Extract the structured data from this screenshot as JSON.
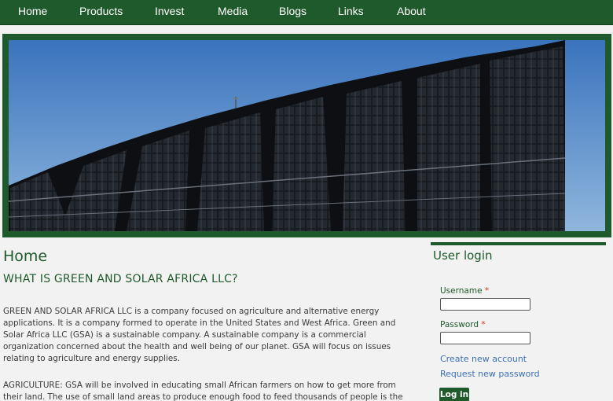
{
  "nav": {
    "items": [
      "Home",
      "Products",
      "Invest",
      "Media",
      "Blogs",
      "Links",
      "About"
    ]
  },
  "banner": {
    "image": "solar-panels-photo"
  },
  "main": {
    "title": "Home",
    "subtitle": "WHAT IS GREEN AND SOLAR AFRICA LLC?",
    "para1": "GREEN AND SOLAR AFRICA LLC is a company focused on agriculture and alternative energy applications. It is a company formed to operate in the United States and West Africa. Green and Solar Africa LLC (GSA) is a sustainable company. A sustainable company is a commercial organization concerned about the health and well being of our planet. GSA will focus on issues relating to agriculture and energy supplies.",
    "para2": "AGRICULTURE: GSA will be involved in educating small African farmers on how to get more from their land. The use of small land areas to produce enough food to feed thousands of people is the"
  },
  "login": {
    "title": "User login",
    "username_label": "Username",
    "password_label": "Password",
    "required_mark": "*",
    "username_value": "",
    "password_value": "",
    "create_account": "Create new account",
    "request_password": "Request new password",
    "submit": "Log in"
  },
  "colors": {
    "brand": "#1e5a2b",
    "link": "#3b6fb6",
    "required": "#d9381e"
  }
}
